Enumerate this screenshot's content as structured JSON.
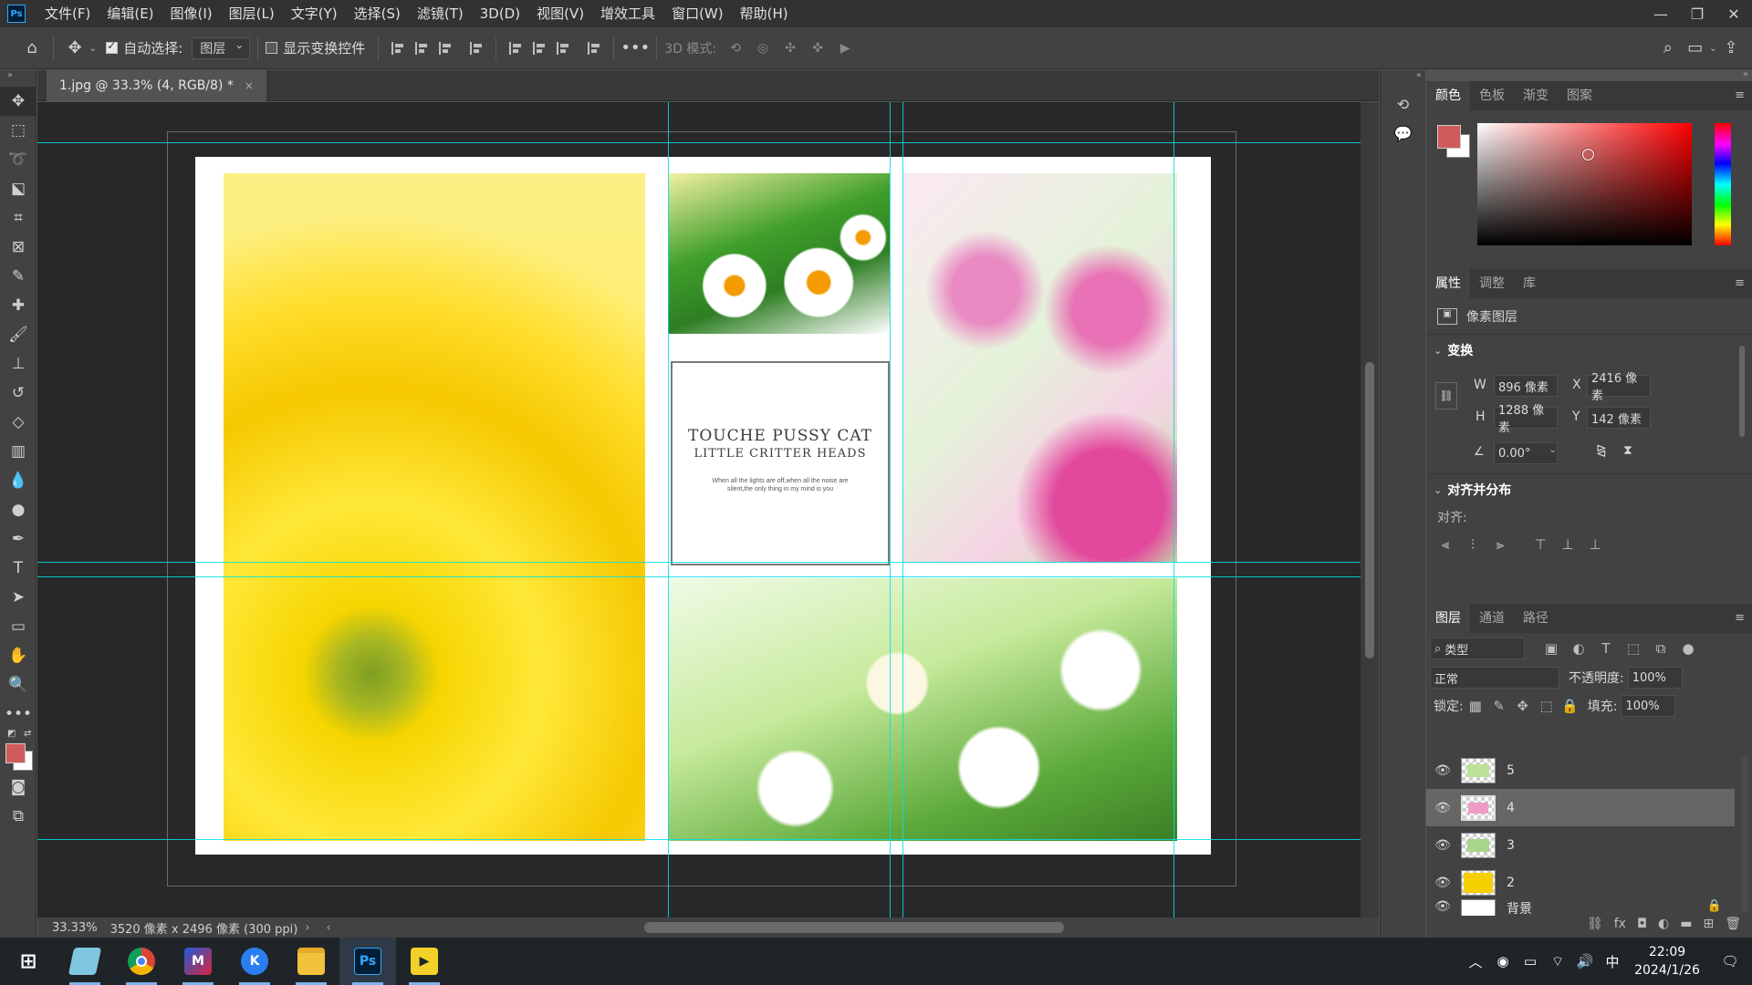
{
  "menubar": {
    "logo": "Ps",
    "items": [
      "文件(F)",
      "编辑(E)",
      "图像(I)",
      "图层(L)",
      "文字(Y)",
      "选择(S)",
      "滤镜(T)",
      "3D(D)",
      "视图(V)",
      "增效工具",
      "窗口(W)",
      "帮助(H)"
    ],
    "minimize": "—",
    "restore": "❐",
    "close": "✕"
  },
  "options": {
    "auto_select_label": "自动选择:",
    "auto_select_checked": true,
    "auto_select_target": "图层",
    "show_transform_label": "显示变换控件",
    "more": "•••",
    "mode_3d_label": "3D 模式:"
  },
  "document": {
    "tab_title": "1.jpg @ 33.3% (4, RGB/8) *",
    "tab_close": "×",
    "zoom": "33.33%",
    "doc_info": "3520 像素 x 2496 像素 (300 ppi)",
    "card_title": "TOUCHE PUSSY CAT",
    "card_subtitle": "LITTLE CRITTER HEADS",
    "card_body": "When all the lights are off,when all the noise are silent,the only thing in my mind is you"
  },
  "color_panel": {
    "tabs": [
      "颜色",
      "色板",
      "渐变",
      "图案"
    ],
    "active_tab": "颜色",
    "foreground": "#cf5b5b",
    "background": "#ffffff"
  },
  "properties_panel": {
    "tabs": [
      "属性",
      "调整",
      "库"
    ],
    "active_tab": "属性",
    "layer_type": "像素图层",
    "transform_title": "变换",
    "w_label": "W",
    "w_value": "896 像素",
    "h_label": "H",
    "h_value": "1288 像素",
    "x_label": "X",
    "x_value": "2416 像素",
    "y_label": "Y",
    "y_value": "142 像素",
    "angle_value": "0.00°",
    "align_title": "对齐并分布",
    "align_label": "对齐:"
  },
  "layers_panel": {
    "tabs": [
      "图层",
      "通道",
      "路径"
    ],
    "active_tab": "图层",
    "filter_label": "类型",
    "blend_mode": "正常",
    "opacity_label": "不透明度:",
    "opacity_value": "100%",
    "lock_label": "锁定:",
    "fill_label": "填充:",
    "fill_value": "100%",
    "layers": [
      {
        "name": "5",
        "selected": false
      },
      {
        "name": "4",
        "selected": true
      },
      {
        "name": "3",
        "selected": false
      },
      {
        "name": "2",
        "selected": false
      },
      {
        "name": "背景",
        "selected": false,
        "locked": true
      }
    ]
  },
  "taskbar": {
    "apps": [
      "Windows",
      "Notepad",
      "Chrome",
      "Mail",
      "K",
      "Explorer",
      "Ps",
      "Player"
    ],
    "ime": "中",
    "time": "22:09",
    "date": "2024/1/26"
  }
}
